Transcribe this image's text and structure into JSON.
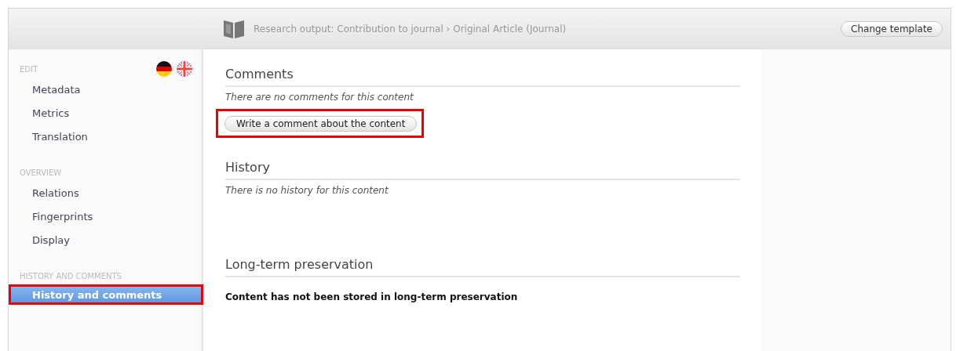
{
  "header": {
    "breadcrumb": "Research output: Contribution to journal › Original Article (Journal)",
    "button": "Change template"
  },
  "sidebar": {
    "groups": [
      {
        "heading": "EDIT",
        "items": [
          {
            "label": "Metadata",
            "selected": false,
            "highlighted": false
          },
          {
            "label": "Metrics",
            "selected": false,
            "highlighted": false
          },
          {
            "label": "Translation",
            "selected": false,
            "highlighted": false
          }
        ]
      },
      {
        "heading": "OVERVIEW",
        "items": [
          {
            "label": "Relations",
            "selected": false,
            "highlighted": false
          },
          {
            "label": "Fingerprints",
            "selected": false,
            "highlighted": false
          },
          {
            "label": "Display",
            "selected": false,
            "highlighted": false
          }
        ]
      },
      {
        "heading": "HISTORY AND COMMENTS",
        "items": [
          {
            "label": "History and comments",
            "selected": true,
            "highlighted": true
          }
        ]
      }
    ]
  },
  "sections": [
    {
      "title": "Comments",
      "note": {
        "text": "There are no comments for this content",
        "kind": "italic"
      },
      "button": {
        "label": "Write a comment about the content",
        "highlighted": true
      }
    },
    {
      "title": "History",
      "note": {
        "text": "There is no history for this content",
        "kind": "italic"
      }
    },
    {
      "title": "Long-term preservation",
      "note": {
        "text": "Content has not been stored in long-term preservation",
        "kind": "bold"
      }
    }
  ]
}
